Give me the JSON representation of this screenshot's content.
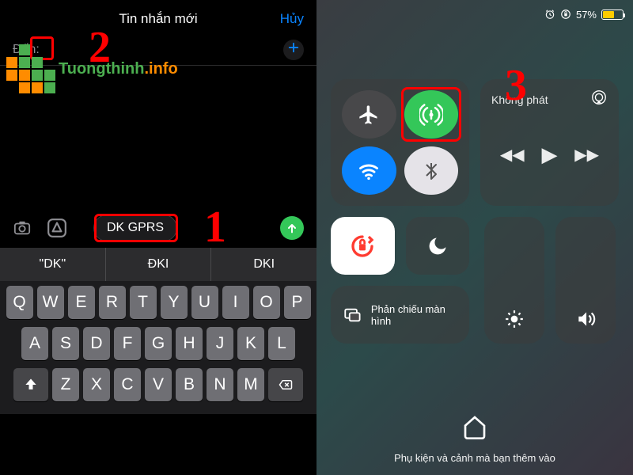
{
  "left": {
    "header": {
      "title": "Tin nhắn mới",
      "cancel": "Hủy"
    },
    "to_label": "Đến:",
    "message_input": "DK GPRS",
    "predictions": [
      "\"DK\"",
      "ĐKI",
      "DKI"
    ],
    "keyboard": {
      "row1": [
        "Q",
        "W",
        "E",
        "R",
        "T",
        "Y",
        "U",
        "I",
        "O",
        "P"
      ],
      "row2": [
        "A",
        "S",
        "D",
        "F",
        "G",
        "H",
        "J",
        "K",
        "L"
      ],
      "row3": [
        "Z",
        "X",
        "C",
        "V",
        "B",
        "N",
        "M"
      ]
    }
  },
  "right": {
    "status": {
      "battery_pct": "57%"
    },
    "media": {
      "title": "Không phát"
    },
    "mirror": {
      "label": "Phản chiếu màn hình"
    },
    "footer": "Phụ kiện và cảnh mà bạn thêm vào"
  },
  "callouts": {
    "one": "1",
    "two": "2",
    "three": "3"
  },
  "watermark": {
    "name": "Tuongthinh",
    "suffix": ".info"
  }
}
